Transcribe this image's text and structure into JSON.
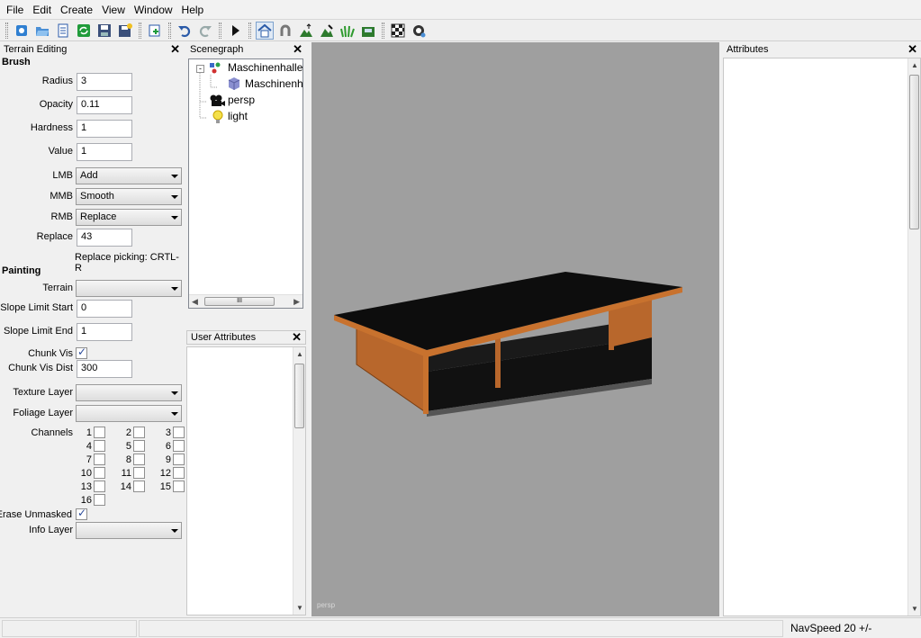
{
  "menu": {
    "file": "File",
    "edit": "Edit",
    "create": "Create",
    "view": "View",
    "window": "Window",
    "help": "Help"
  },
  "toolbar": {
    "icons": [
      "gear-icon",
      "open-icon",
      "list-icon",
      "refresh-icon",
      "save-icon",
      "save-as-icon",
      "new-node-icon",
      "undo-icon",
      "redo-icon",
      "play-icon",
      "home-icon",
      "magnet-icon",
      "terrain-raise-icon",
      "terrain-paint-icon",
      "foliage-icon",
      "export-icon",
      "checker-icon",
      "settings-icon"
    ]
  },
  "terrain": {
    "title": "Terrain Editing",
    "brush_section": "Brush",
    "radius_label": "Radius",
    "radius_value": "3",
    "opacity_label": "Opacity",
    "opacity_value": "0.11",
    "hardness_label": "Hardness",
    "hardness_value": "1",
    "value_label": "Value",
    "value_value": "1",
    "lmb_label": "LMB",
    "lmb_value": "Add",
    "mmb_label": "MMB",
    "mmb_value": "Smooth",
    "rmb_label": "RMB",
    "rmb_value": "Replace",
    "replace_label": "Replace",
    "replace_value": "43",
    "replace_hint": "Replace picking: CRTL-R",
    "painting_section": "Painting",
    "terrain_label": "Terrain",
    "terrain_value": "",
    "slope_start_label": "Slope Limit Start",
    "slope_start_value": "0",
    "slope_end_label": "Slope Limit End",
    "slope_end_value": "1",
    "chunk_vis_label": "Chunk Vis",
    "chunk_vis_checked": true,
    "chunk_vis_dist_label": "Chunk Vis Dist",
    "chunk_vis_dist_value": "300",
    "texture_layer_label": "Texture Layer",
    "texture_layer_value": "",
    "foliage_layer_label": "Foliage Layer",
    "foliage_layer_value": "",
    "channels_label": "Channels",
    "channels": [
      "1",
      "2",
      "3",
      "4",
      "5",
      "6",
      "7",
      "8",
      "9",
      "10",
      "11",
      "12",
      "13",
      "14",
      "15",
      "16"
    ],
    "erase_unmasked_label": "Erase Unmasked",
    "erase_unmasked_checked": true,
    "info_layer_label": "Info Layer",
    "info_layer_value": ""
  },
  "scenegraph": {
    "title": "Scenegraph",
    "items": {
      "root": "Maschinenhalle",
      "child": "Maschinenh",
      "persp": "persp",
      "light": "light"
    },
    "hscroll_grip": "III"
  },
  "user_attributes": {
    "title": "User Attributes"
  },
  "viewport": {
    "camera_label": "persp"
  },
  "attributes": {
    "title": "Attributes"
  },
  "status": {
    "navspeed": "NavSpeed 20 +/-"
  }
}
